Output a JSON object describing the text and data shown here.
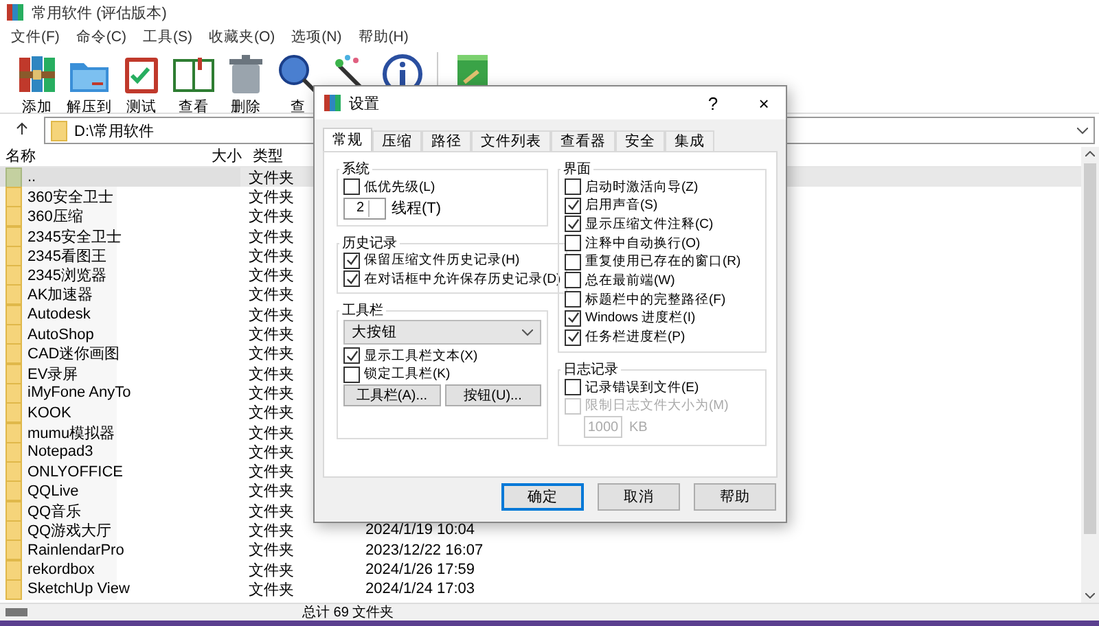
{
  "window": {
    "title": "常用软件 (评估版本)"
  },
  "menu": [
    "文件(F)",
    "命令(C)",
    "工具(S)",
    "收藏夹(O)",
    "选项(N)",
    "帮助(H)"
  ],
  "toolbar": [
    {
      "label": "添加",
      "kind": "archive"
    },
    {
      "label": "解压到",
      "kind": "extract"
    },
    {
      "label": "测试",
      "kind": "test"
    },
    {
      "label": "查看",
      "kind": "view"
    },
    {
      "label": "删除",
      "kind": "delete"
    },
    {
      "label": "查",
      "kind": "find"
    },
    {
      "kind": "wizard"
    },
    {
      "kind": "info"
    },
    {
      "kind": "book"
    }
  ],
  "address": "D:\\常用软件",
  "columns": [
    "名称",
    "大小",
    "类型"
  ],
  "rows": [
    {
      "name": "..",
      "kind": "up",
      "type": "文件夹",
      "selected": true
    },
    {
      "name": "360安全卫士",
      "kind": "folder",
      "type": "文件夹",
      "selected": false
    },
    {
      "name": "360压缩",
      "kind": "folder",
      "type": "文件夹",
      "selected": false
    },
    {
      "name": "2345安全卫士",
      "kind": "folder",
      "type": "文件夹",
      "selected": false
    },
    {
      "name": "2345看图王",
      "kind": "folder",
      "type": "文件夹",
      "selected": false
    },
    {
      "name": "2345浏览器",
      "kind": "folder",
      "type": "文件夹",
      "selected": false
    },
    {
      "name": "AK加速器",
      "kind": "folder",
      "type": "文件夹",
      "selected": false
    },
    {
      "name": "Autodesk",
      "kind": "folder",
      "type": "文件夹",
      "selected": false
    },
    {
      "name": "AutoShop",
      "kind": "folder",
      "type": "文件夹",
      "selected": false
    },
    {
      "name": "CAD迷你画图",
      "kind": "folder",
      "type": "文件夹",
      "selected": false
    },
    {
      "name": "EV录屏",
      "kind": "folder",
      "type": "文件夹",
      "selected": false
    },
    {
      "name": "iMyFone AnyTo",
      "kind": "folder",
      "type": "文件夹",
      "selected": false
    },
    {
      "name": "KOOK",
      "kind": "folder",
      "type": "文件夹",
      "selected": false
    },
    {
      "name": "mumu模拟器",
      "kind": "folder",
      "type": "文件夹",
      "selected": false
    },
    {
      "name": "Notepad3",
      "kind": "folder",
      "type": "文件夹",
      "selected": false
    },
    {
      "name": "ONLYOFFICE",
      "kind": "folder",
      "type": "文件夹",
      "selected": false
    },
    {
      "name": "QQLive",
      "kind": "folder",
      "type": "文件夹",
      "selected": false
    },
    {
      "name": "QQ音乐",
      "kind": "folder",
      "type": "文件夹",
      "selected": false
    },
    {
      "name": "QQ游戏大厅",
      "kind": "folder",
      "type": "文件夹",
      "modified": "2024/1/19 10:04",
      "selected": false
    },
    {
      "name": "RainlendarPro",
      "kind": "folder",
      "type": "文件夹",
      "modified": "2023/12/22 16:07",
      "selected": false
    },
    {
      "name": "rekordbox",
      "kind": "folder",
      "type": "文件夹",
      "modified": "2024/1/26 17:59",
      "selected": false
    },
    {
      "name": "SketchUp View",
      "kind": "folder",
      "type": "文件夹",
      "modified": "2024/1/24 17:03",
      "selected": false
    }
  ],
  "status_bar": "总计 69 文件夹",
  "dialog": {
    "title": "设置",
    "help": "?",
    "close": "×",
    "tabs": [
      {
        "label": "常规",
        "selected": true
      },
      {
        "label": "压缩",
        "selected": false
      },
      {
        "label": "路径",
        "selected": false
      },
      {
        "label": "文件列表",
        "selected": false
      },
      {
        "label": "查看器",
        "selected": false
      },
      {
        "label": "安全",
        "selected": false
      },
      {
        "label": "集成",
        "selected": false
      }
    ],
    "system": {
      "title": "系统",
      "low_priority": {
        "label": "低优先级(L)",
        "checked": false
      },
      "threads": {
        "value": "2",
        "label": "线程(T)"
      }
    },
    "history": {
      "title": "历史记录",
      "items": [
        {
          "label": "保留压缩文件历史记录(H)",
          "checked": true
        },
        {
          "label": "在对话框中允许保存历史记录(D)",
          "checked": true
        }
      ]
    },
    "toolbar": {
      "title": "工具栏",
      "dropdown": "大按钮",
      "items": [
        {
          "label": "显示工具栏文本(X)",
          "checked": true
        },
        {
          "label": "锁定工具栏(K)",
          "checked": false
        }
      ],
      "buttons": [
        "工具栏(A)...",
        "按钮(U)..."
      ]
    },
    "interface": {
      "title": "界面",
      "items": [
        {
          "label": "启动时激活向导(Z)",
          "checked": false
        },
        {
          "label": "启用声音(S)",
          "checked": true
        },
        {
          "label": "显示压缩文件注释(C)",
          "checked": true
        },
        {
          "label": "注释中自动换行(O)",
          "checked": false
        },
        {
          "label": "重复使用已存在的窗口(R)",
          "checked": false
        },
        {
          "label": "总在最前端(W)",
          "checked": false
        },
        {
          "label": "标题栏中的完整路径(F)",
          "checked": false
        },
        {
          "label": "Windows 进度栏(I)",
          "checked": true
        },
        {
          "label": "任务栏进度栏(P)",
          "checked": true
        }
      ]
    },
    "log": {
      "title": "日志记录",
      "items": [
        {
          "label": "记录错误到文件(E)",
          "checked": false,
          "disabled": false
        },
        {
          "label": "限制日志文件大小为(M)",
          "checked": false,
          "disabled": true
        }
      ],
      "size": {
        "value": "1000",
        "unit": "KB",
        "disabled": true
      }
    },
    "buttons": [
      {
        "label": "确定",
        "default": true
      },
      {
        "label": "取消",
        "default": false
      },
      {
        "label": "帮助",
        "default": false
      }
    ]
  }
}
